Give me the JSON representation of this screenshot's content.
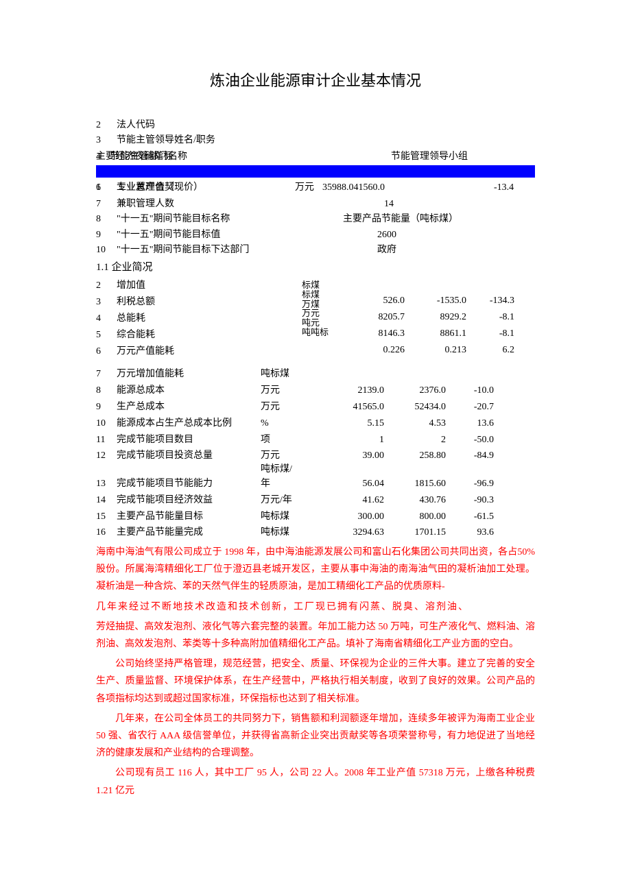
{
  "title": "炼油企业能源审计企业基本情况",
  "top_items": {
    "i2": {
      "n": "2",
      "label": "法人代码"
    },
    "i3": {
      "n": "3",
      "label": "节能主管领导姓名/职务"
    },
    "overlay_left_a": "主要经济夜硝指标",
    "overlay_left_b": "4    节能主管部门名称",
    "overlay_right": "节能管理领导小组",
    "i6a": {
      "n": "6",
      "label": "专业置理合契"
    },
    "i6b": {
      "n": "1",
      "label": "工业总产值（现价）"
    },
    "i6_unit": "万元",
    "i6_val": "35988.041560.0",
    "i6_v3": "-13.4",
    "i7": {
      "n": "7",
      "label": "兼职管理人数",
      "val": "14"
    },
    "i8": {
      "n": "8",
      "label": "\"十一五\"期间节能目标名称",
      "val": "主要产品节能量（吨标煤）"
    },
    "i9": {
      "n": "9",
      "label": "\"十一五\"期间节能目标值",
      "val": "2600"
    },
    "i10": {
      "n": "10",
      "label": "\"十一五\"期间节能目标下达部门",
      "val": "政府"
    }
  },
  "section_1_1": "1.1 企业简况",
  "table": {
    "r2": {
      "n": "2",
      "lbl": "增加值",
      "unit": "标煤"
    },
    "r3": {
      "n": "3",
      "lbl": "利税总额",
      "unit": "标煤",
      "v1": "526.0",
      "v2": "-1535.0",
      "v3": "-134.3"
    },
    "r4": {
      "n": "4",
      "lbl": "总能耗",
      "unit": "万煤",
      "v1": "8205.7",
      "v2": "8929.2",
      "v3": "-8.1"
    },
    "r5": {
      "n": "5",
      "lbl": "综合能耗",
      "unit": "万元",
      "v1": "8146.3",
      "v2": "8861.1",
      "v3": "-8.1"
    },
    "r6": {
      "n": "6",
      "lbl": "万元产值能耗",
      "unit": "吨元",
      "unit2": "吨吨标",
      "v1": "0.226",
      "v2": "0.213",
      "v3": "6.2"
    },
    "r7": {
      "n": "7",
      "lbl": "万元增加值能耗",
      "unit": "吨标煤"
    },
    "r8": {
      "n": "8",
      "lbl": "能源总成本",
      "unit": "万元",
      "v1": "2139.0",
      "v2": "2376.0",
      "v3": "-10.0"
    },
    "r9": {
      "n": "9",
      "lbl": "生产总成本",
      "unit": "万元",
      "v1": "41565.0",
      "v2": "52434.0",
      "v3": "-20.7"
    },
    "r10": {
      "n": "10",
      "lbl": "能源成本占生产总成本比例",
      "unit": "%",
      "v1": "5.15",
      "v2": "4.53",
      "v3": "13.6"
    },
    "r11": {
      "n": "11",
      "lbl": "完成节能项目数目",
      "unit": "项",
      "v1": "1",
      "v2": "2",
      "v3": "-50.0"
    },
    "r12": {
      "n": "12",
      "lbl": "完成节能项目投资总量",
      "unit": "万元",
      "v1": "39.00",
      "v2": "258.80",
      "v3": "-84.9"
    },
    "r13": {
      "n": "13",
      "lbl": "完成节能项目节能能力",
      "unit": "吨标煤/",
      "unit2": "年",
      "v1": "56.04",
      "v2": "1815.60",
      "v3": "-96.9"
    },
    "r14": {
      "n": "14",
      "lbl": "完成节能项目经济效益",
      "unit": "万元/年",
      "v1": "41.62",
      "v2": "430.76",
      "v3": "-90.3"
    },
    "r15": {
      "n": "15",
      "lbl": "主要产品节能量目标",
      "unit": "吨标煤",
      "v1": "300.00",
      "v2": "800.00",
      "v3": "-61.5"
    },
    "r16": {
      "n": "16",
      "lbl": "主要产品节能量完成",
      "unit": "吨标煤",
      "v1": "3294.63",
      "v2": "1701.15",
      "v3": "93.6"
    }
  },
  "paras": {
    "p1a": "海南中海油气有限公司成立于 1998 年，由中海油能源发展公司和富山石化集团公司共同出资，各占50%股份。所属海湾精细化工厂位于澄迈县老城开发区，主要从事中海油的南海油气田的凝析油加工处理。凝析油是一种含烷、苯的天然气伴生的轻质原油，是加工精细化工产品的优质原料-",
    "p1b": "几年来经过不断地技术改造和技术创新，工厂现已拥有闪蒸、脱臭、溶剂油、",
    "p1c": "芳烃抽提、高效发泡剂、液化气等六套完整的装置。年加工能力达 50 万吨，可生产液化气、燃料油、溶剂油、高效发泡剂、苯类等十多种高附加值精细化工产品。填补了海南省精细化工产业方面的空白。",
    "p2": "公司始终坚持严格管理，规范经营，把安全、质量、环保视为企业的三件大事。建立了完善的安全生产、质量监督、环境保护体系，在生产经营中，严格执行相关制度，收到了良好的效果。公司产品的各项指标均达到或超过国家标准，环保指标也达到了相关标准。",
    "p3": "几年来，在公司全体员工的共同努力下，销售额和利润额逐年增加，连续多年被评为海南工业企业 50 强、省农行 AAA 级信誉单位，并获得省高新企业突出贡献奖等各项荣誉称号，有力地促进了当地经济的健康发展和产业结构的合理调整。",
    "p4": "公司现有员工 116 人，其中工厂 95 人，公司 22 人。2008 年工业产值 57318 万元，上缴各种税费 1.21 亿元"
  }
}
